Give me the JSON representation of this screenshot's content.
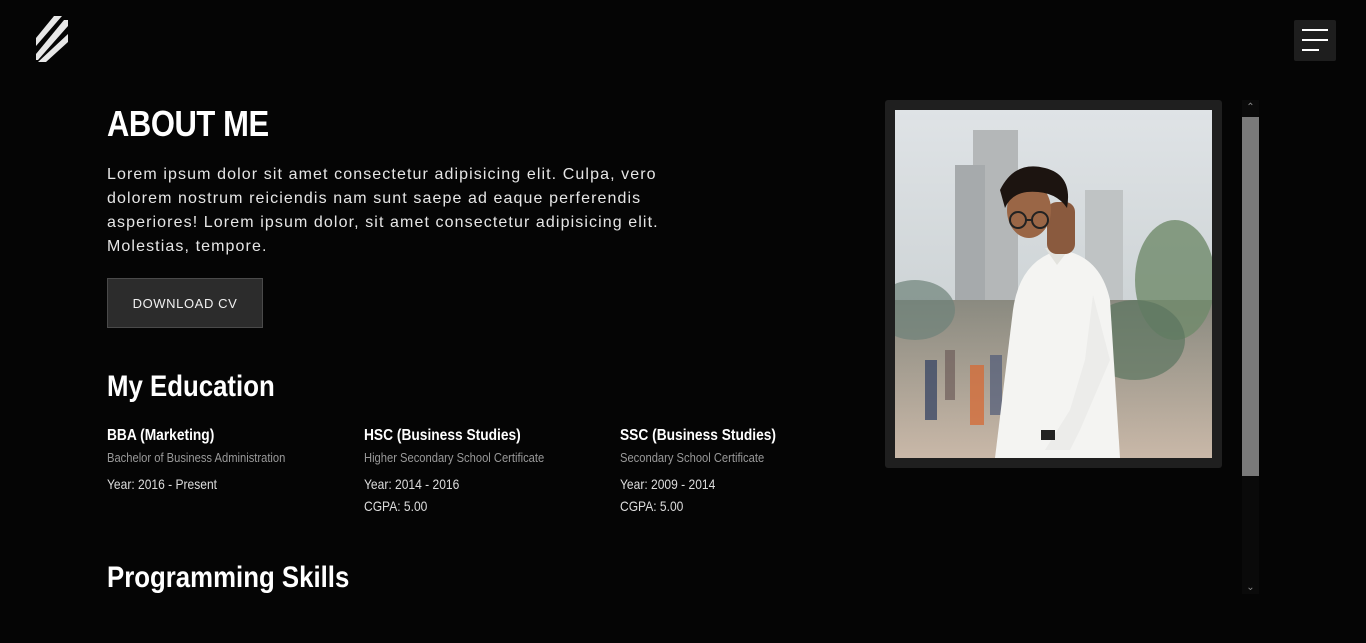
{
  "header": {
    "logo_icon": "slash-stripes-logo-icon",
    "menu_icon": "hamburger-menu-icon"
  },
  "about": {
    "title": "ABOUT ME",
    "text": "Lorem ipsum dolor sit amet consectetur adipisicing elit. Culpa, vero dolorem nostrum reiciendis nam sunt saepe ad eaque perferendis asperiores! Lorem ipsum dolor, sit amet consectetur adipisicing elit. Molestias, tempore.",
    "download_label": "DOWNLOAD CV"
  },
  "education": {
    "title": "My Education",
    "items": [
      {
        "degree": "BBA (Marketing)",
        "full": "Bachelor of Business Administration",
        "year": "Year: 2016 - Present",
        "cgpa": ""
      },
      {
        "degree": "HSC (Business Studies)",
        "full": "Higher Secondary School Certificate",
        "year": "Year: 2014 - 2016",
        "cgpa": "CGPA: 5.00"
      },
      {
        "degree": "SSC (Business Studies)",
        "full": "Secondary School Certificate",
        "year": "Year: 2009 - 2014",
        "cgpa": "CGPA: 5.00"
      }
    ]
  },
  "skills": {
    "title": "Programming Skills"
  },
  "colors": {
    "background": "#050505",
    "button_bg": "#2c2c2c",
    "frame_bg": "#1f1f1f",
    "muted_text": "#9a9a9a"
  }
}
